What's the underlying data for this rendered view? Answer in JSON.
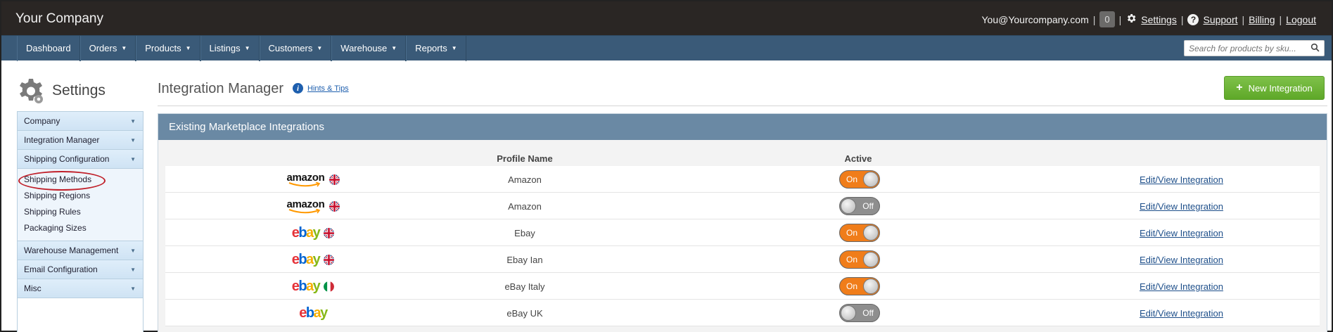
{
  "header": {
    "brand": "Your Company",
    "user_email": "You@Yourcompany.com",
    "notification_count": "0",
    "settings_label": "Settings",
    "support_label": "Support",
    "billing_label": "Billing",
    "logout_label": "Logout"
  },
  "nav": {
    "items": [
      {
        "label": "Dashboard",
        "dropdown": false
      },
      {
        "label": "Orders",
        "dropdown": true
      },
      {
        "label": "Products",
        "dropdown": true
      },
      {
        "label": "Listings",
        "dropdown": true
      },
      {
        "label": "Customers",
        "dropdown": true
      },
      {
        "label": "Warehouse",
        "dropdown": true
      },
      {
        "label": "Reports",
        "dropdown": true
      }
    ],
    "search_placeholder": "Search for products by sku..."
  },
  "sidebar": {
    "title": "Settings",
    "groups": [
      {
        "label": "Company"
      },
      {
        "label": "Integration Manager"
      },
      {
        "label": "Shipping Configuration",
        "items": [
          "Shipping Methods",
          "Shipping Regions",
          "Shipping Rules",
          "Packaging Sizes"
        ]
      },
      {
        "label": "Warehouse Management"
      },
      {
        "label": "Email Configuration"
      },
      {
        "label": "Misc"
      }
    ],
    "highlighted_item": "Shipping Methods",
    "highlight_color": "#c0202a"
  },
  "main": {
    "title": "Integration Manager",
    "hints_label": "Hints & Tips",
    "new_button_label": "New Integration",
    "panel_title": "Existing Marketplace Integrations",
    "columns": {
      "profile": "Profile Name",
      "active": "Active"
    },
    "rows": [
      {
        "marketplace": "amazon",
        "logo_text": "amazon",
        "flag": "uk",
        "profile": "Amazon",
        "active": true,
        "toggle_label": "On",
        "link": "Edit/View Integration"
      },
      {
        "marketplace": "amazon",
        "logo_text": "amazon",
        "flag": "uk",
        "profile": "Amazon",
        "active": false,
        "toggle_label": "Off",
        "link": "Edit/View Integration"
      },
      {
        "marketplace": "ebay",
        "logo_text": "ebay",
        "flag": "uk",
        "profile": "Ebay",
        "active": true,
        "toggle_label": "On",
        "link": "Edit/View Integration"
      },
      {
        "marketplace": "ebay",
        "logo_text": "ebay",
        "flag": "uk",
        "profile": "Ebay Ian",
        "active": true,
        "toggle_label": "On",
        "link": "Edit/View Integration"
      },
      {
        "marketplace": "ebay",
        "logo_text": "ebay",
        "flag": "it",
        "profile": "eBay Italy",
        "active": true,
        "toggle_label": "On",
        "link": "Edit/View Integration"
      },
      {
        "marketplace": "ebay",
        "logo_text": "ebay",
        "flag": "none",
        "profile": "eBay UK",
        "active": false,
        "toggle_label": "Off",
        "link": "Edit/View Integration"
      }
    ]
  },
  "colors": {
    "topbar": "#2a2624",
    "navbar": "#3a5a78",
    "panel_header": "#6a89a4",
    "toggle_on": "#f07d1a",
    "toggle_off": "#8e8e8e",
    "new_button": "#6ab436",
    "link": "#1e4f8a"
  }
}
